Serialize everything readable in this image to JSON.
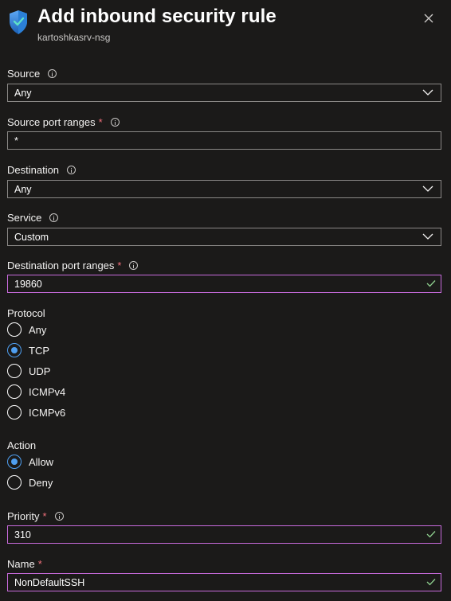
{
  "header": {
    "title": "Add inbound security rule",
    "subtitle": "kartoshkasrv-nsg",
    "icon": "shield-icon",
    "close_icon": "close-icon"
  },
  "fields": {
    "source": {
      "label": "Source",
      "value": "Any"
    },
    "source_port_ranges": {
      "label": "Source port ranges",
      "required": "*",
      "value": "*"
    },
    "destination": {
      "label": "Destination",
      "value": "Any"
    },
    "service": {
      "label": "Service",
      "value": "Custom"
    },
    "destination_port_ranges": {
      "label": "Destination port ranges",
      "required": "*",
      "value": "19860"
    },
    "priority": {
      "label": "Priority",
      "required": "*",
      "value": "310"
    },
    "name": {
      "label": "Name",
      "required": "*",
      "value": "NonDefaultSSH"
    }
  },
  "protocol": {
    "label": "Protocol",
    "options": [
      "Any",
      "TCP",
      "UDP",
      "ICMPv4",
      "ICMPv6"
    ],
    "selected": "TCP"
  },
  "action": {
    "label": "Action",
    "options": [
      "Allow",
      "Deny"
    ],
    "selected": "Allow"
  },
  "colors": {
    "background": "#1b1a19",
    "input_border": "#8a8886",
    "valid_border": "#c86bdc",
    "valid_check": "#8fd18f",
    "radio_accent": "#4f9ff0",
    "required": "#f1707b"
  }
}
